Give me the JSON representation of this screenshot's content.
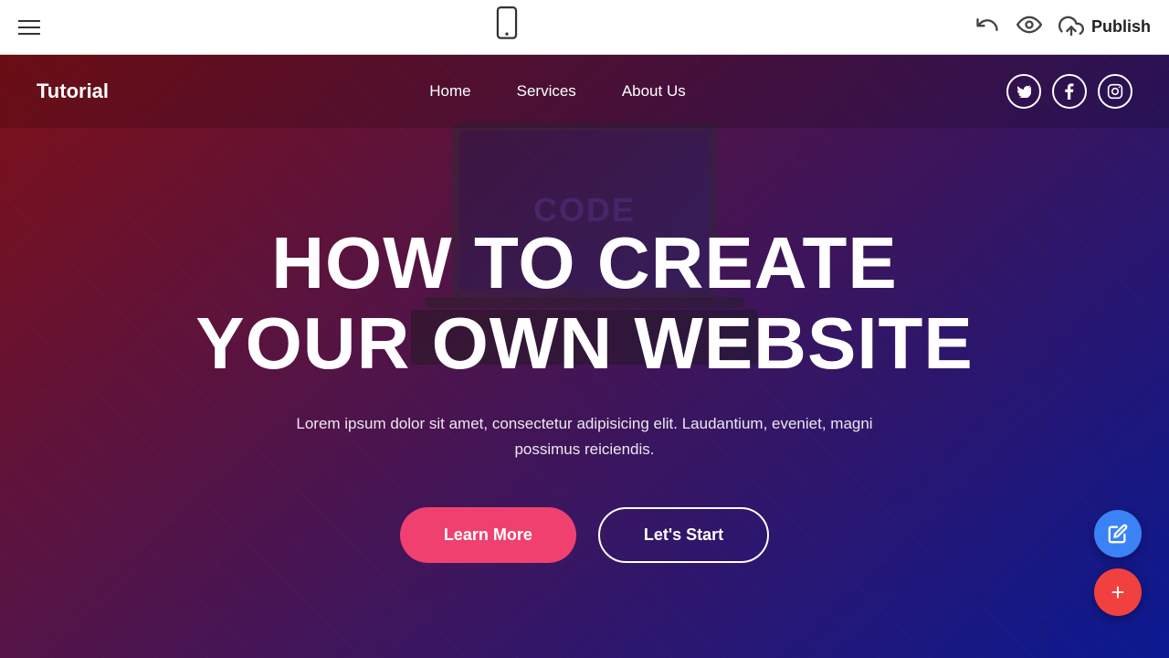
{
  "toolbar": {
    "hamburger_label": "menu",
    "mobile_icon_symbol": "📱",
    "undo_icon_symbol": "↩",
    "eye_icon_symbol": "👁",
    "publish_label": "Publish",
    "cloud_icon_symbol": "☁"
  },
  "site": {
    "logo": "Tutorial",
    "nav": {
      "links": [
        {
          "label": "Home",
          "href": "#"
        },
        {
          "label": "Services",
          "href": "#"
        },
        {
          "label": "About Us",
          "href": "#"
        }
      ],
      "social": [
        {
          "name": "twitter",
          "symbol": "𝕏"
        },
        {
          "name": "facebook",
          "symbol": "f"
        },
        {
          "name": "instagram",
          "symbol": "in"
        }
      ]
    },
    "hero": {
      "title_line1": "HOW TO CREATE",
      "title_line2": "YOUR OWN WEBSITE",
      "subtitle": "Lorem ipsum dolor sit amet, consectetur adipisicing elit. Laudantium, eveniet, magni possimus reiciendis.",
      "btn_learn_more": "Learn More",
      "btn_lets_start": "Let's Start"
    }
  },
  "fab": {
    "pencil_symbol": "✏",
    "plus_symbol": "+"
  }
}
